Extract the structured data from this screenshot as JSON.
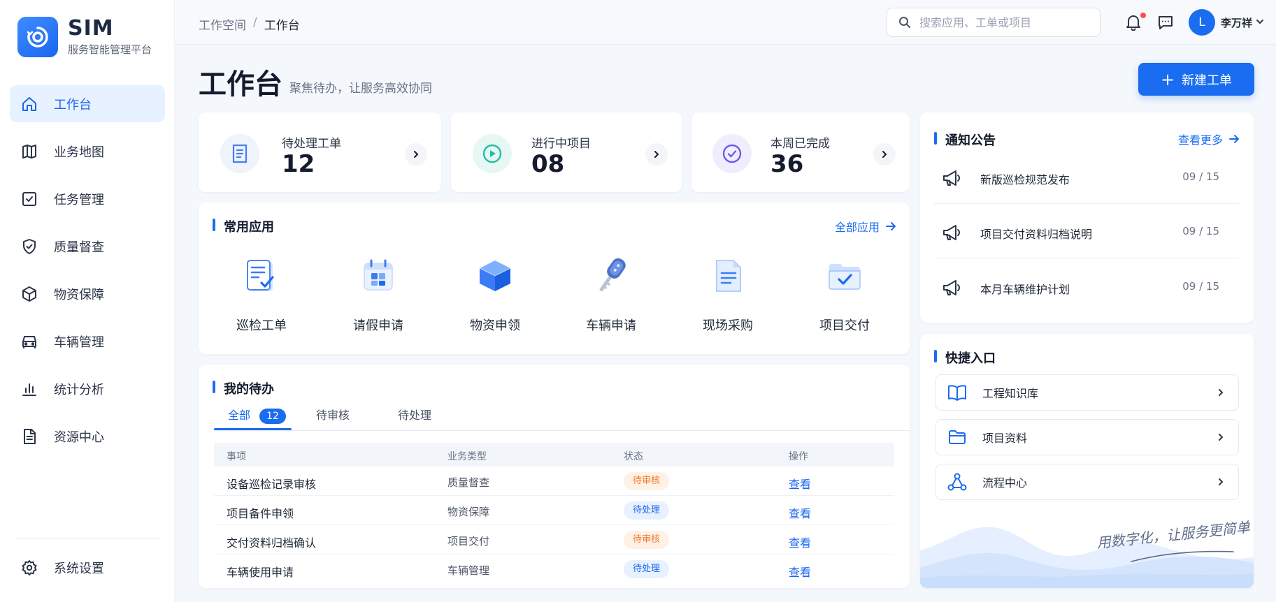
{
  "brand": {
    "name": "SIM",
    "subtitle": "服务智能管理平台"
  },
  "nav": {
    "items": [
      {
        "label": "工作台",
        "icon": "home-icon",
        "active": true
      },
      {
        "label": "业务地图",
        "icon": "map-icon"
      },
      {
        "label": "任务管理",
        "icon": "task-icon"
      },
      {
        "label": "质量督查",
        "icon": "shield-icon"
      },
      {
        "label": "物资保障",
        "icon": "box-icon"
      },
      {
        "label": "车辆管理",
        "icon": "car-icon"
      },
      {
        "label": "统计分析",
        "icon": "chart-icon"
      },
      {
        "label": "资源中心",
        "icon": "document-icon"
      }
    ],
    "settings": {
      "label": "系统设置",
      "icon": "gear-icon"
    }
  },
  "topbar": {
    "breadcrumb": [
      "工作空间",
      "工作台"
    ],
    "breadcrumb_sep": "/",
    "search_placeholder": "搜索应用、工单或项目",
    "user": {
      "initial": "L",
      "name": "李万祥"
    }
  },
  "page": {
    "title": "工作台",
    "subtitle": "聚焦待办，让服务高效协同",
    "new_button": "新建工单",
    "new_button_icon": "plus-icon"
  },
  "stats": [
    {
      "label": "待处理工单",
      "value": "12",
      "icon": "document-icon",
      "color": "#4a7cf0",
      "bg": "#eef3fc"
    },
    {
      "label": "进行中项目",
      "value": "08",
      "icon": "play-icon",
      "color": "#1fbfa8",
      "bg": "#e7f8f4"
    },
    {
      "label": "本周已完成",
      "value": "36",
      "icon": "check-circle-icon",
      "color": "#6a5cf0",
      "bg": "#f0eefd"
    }
  ],
  "apps": {
    "title": "常用应用",
    "more": "全部应用",
    "items": [
      {
        "label": "巡检工单",
        "icon": "checklist-icon"
      },
      {
        "label": "请假申请",
        "icon": "calendar-icon"
      },
      {
        "label": "物资申领",
        "icon": "cube-icon"
      },
      {
        "label": "车辆申请",
        "icon": "car-key-icon"
      },
      {
        "label": "现场采购",
        "icon": "document-icon"
      },
      {
        "label": "项目交付",
        "icon": "folder-check-icon"
      }
    ]
  },
  "todo": {
    "title": "我的待办",
    "tabs": [
      {
        "label": "全部",
        "badge": "12",
        "active": true
      },
      {
        "label": "待审核"
      },
      {
        "label": "待处理"
      }
    ],
    "columns": [
      "事项",
      "业务类型",
      "状态",
      "操作"
    ],
    "rows": [
      {
        "item": "设备巡检记录审核",
        "type": "质量督查",
        "status": "待审核",
        "status_kind": "review",
        "action": "查看"
      },
      {
        "item": "项目备件申领",
        "type": "物资保障",
        "status": "待处理",
        "status_kind": "pending",
        "action": "查看"
      },
      {
        "item": "交付资料归档确认",
        "type": "项目交付",
        "status": "待审核",
        "status_kind": "review",
        "action": "查看"
      },
      {
        "item": "车辆使用申请",
        "type": "车辆管理",
        "status": "待处理",
        "status_kind": "pending",
        "action": "查看"
      }
    ]
  },
  "notices": {
    "title": "通知公告",
    "more": "查看更多",
    "items": [
      {
        "text": "新版巡检规范发布",
        "date": "09 / 15",
        "icon": "megaphone-icon"
      },
      {
        "text": "项目交付资料归档说明",
        "date": "09 / 15",
        "icon": "megaphone-icon"
      },
      {
        "text": "本月车辆维护计划",
        "date": "09 / 15",
        "icon": "megaphone-icon"
      }
    ]
  },
  "quick": {
    "title": "快捷入口",
    "items": [
      {
        "label": "工程知识库",
        "icon": "book-icon"
      },
      {
        "label": "项目资料",
        "icon": "folder-icon"
      },
      {
        "label": "流程中心",
        "icon": "flow-icon"
      }
    ],
    "slogan": "用数字化，让服务更简单"
  },
  "colors": {
    "accent": "#1a6cf0",
    "review": "#f07a2b",
    "pending": "#1a66f0"
  }
}
